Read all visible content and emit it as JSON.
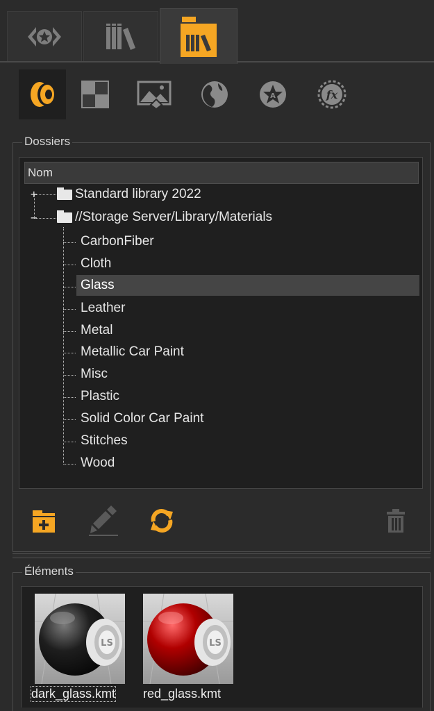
{
  "tabs": [
    {
      "name": "scene-tab",
      "icon": "star-diamond-icon",
      "active": false
    },
    {
      "name": "library-tab",
      "icon": "library-books-icon",
      "active": false
    },
    {
      "name": "library-folder-tab",
      "icon": "library-folder-icon",
      "active": true
    }
  ],
  "subtabs": [
    {
      "icon": "materials-icon",
      "active": true
    },
    {
      "icon": "textures-checker-icon",
      "active": false
    },
    {
      "icon": "image-icon",
      "active": false
    },
    {
      "icon": "environment-globe-icon",
      "active": false
    },
    {
      "icon": "animation-icon",
      "active": false
    },
    {
      "icon": "fx-icon",
      "active": false
    }
  ],
  "folders": {
    "title": "Dossiers",
    "header": "Nom",
    "roots": [
      {
        "label": "Standard library 2022",
        "expander": "+"
      },
      {
        "label": "//Storage Server/Library/Materials",
        "expander": "−"
      }
    ],
    "children": [
      "CarbonFiber",
      "Cloth",
      "Glass",
      "Leather",
      "Metal",
      "Metallic Car Paint",
      "Misc",
      "Plastic",
      "Solid Color Car Paint",
      "Stitches",
      "Wood"
    ],
    "selected": "Glass"
  },
  "toolbar": {
    "new_folder_icon": "new-folder-icon",
    "edit_icon": "edit-brush-icon",
    "refresh_icon": "refresh-icon",
    "delete_icon": "trash-icon"
  },
  "elements": {
    "title": "Éléments",
    "items": [
      {
        "label": "dark_glass.kmt",
        "color": "#1a1a1a",
        "selected": true
      },
      {
        "label": "red_glass.kmt",
        "color": "#b00000",
        "selected": false
      }
    ]
  },
  "colors": {
    "accent": "#f5a623",
    "panel": "#2b2b2b",
    "tree_bg": "#1f1f1f",
    "selection": "#454545"
  }
}
